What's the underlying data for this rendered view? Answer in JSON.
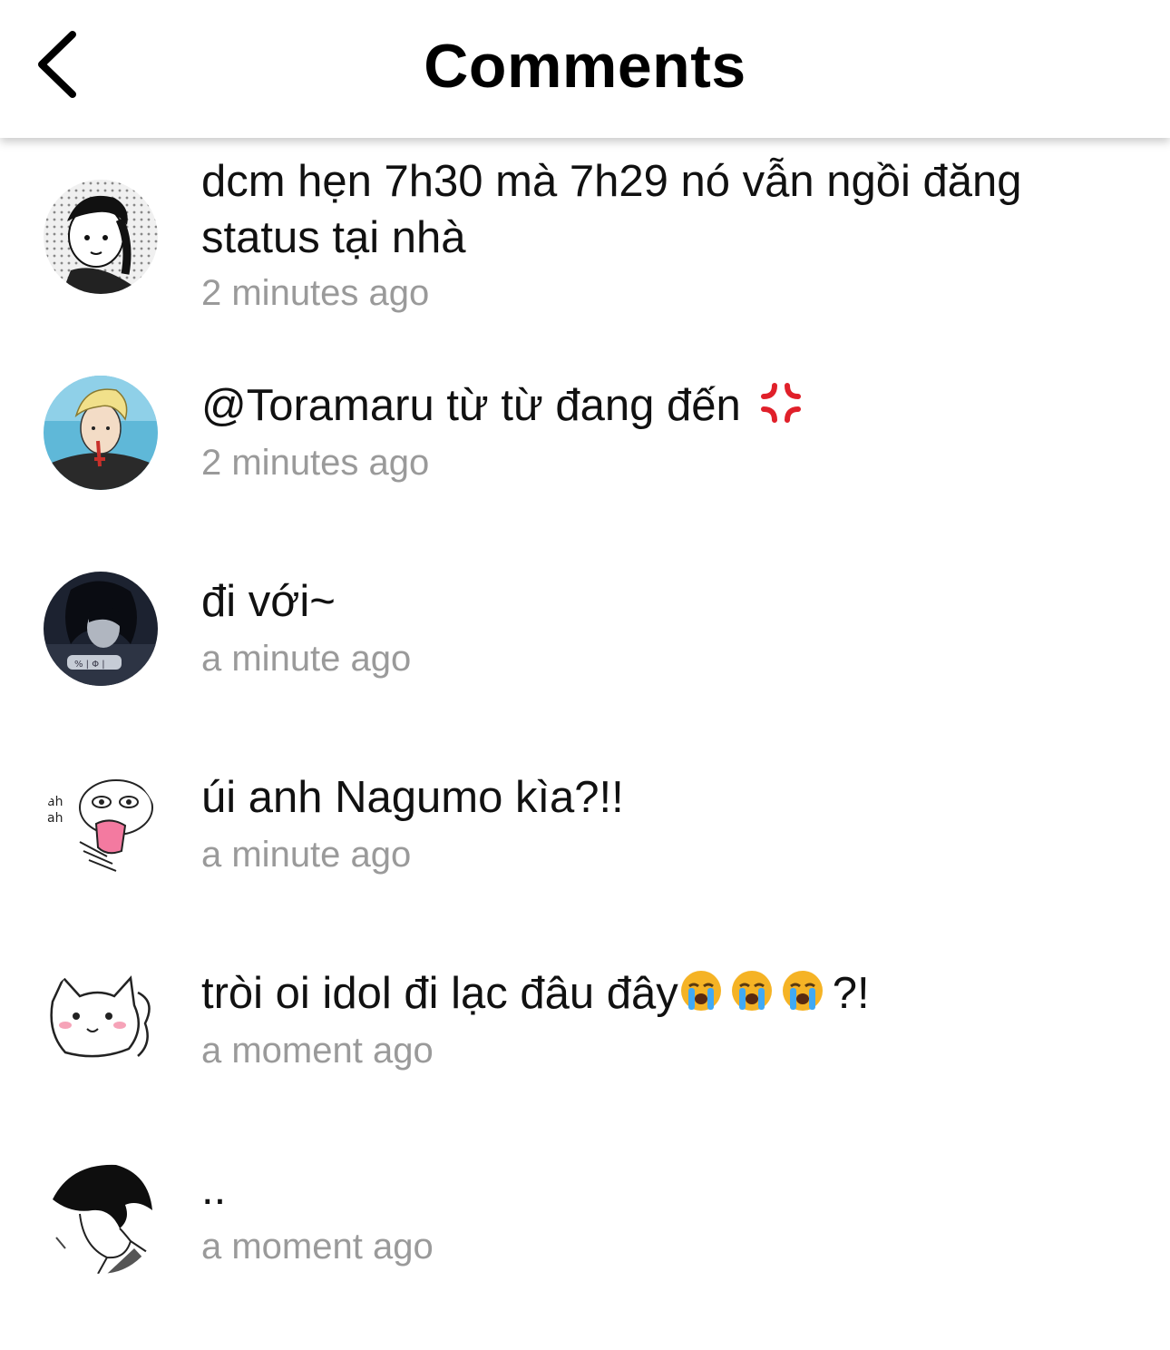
{
  "header": {
    "title": "Comments",
    "back_icon": "chevron-left-icon"
  },
  "comments": [
    {
      "text": "dcm hẹn 7h30 mà 7h29 nó vẫn ngồi đăng status tại nhà",
      "time": "2 minutes ago",
      "avatar": "manga-girl-braids-avatar"
    },
    {
      "text": "@Toramaru từ từ đang đến",
      "emoji": [
        "anger-symbol-emoji"
      ],
      "time": "2 minutes ago",
      "avatar": "blond-character-avatar"
    },
    {
      "text": "đi với~",
      "time": "a minute ago",
      "avatar": "dark-haired-character-avatar"
    },
    {
      "text": "úi anh Nagumo kìa?!!",
      "time": "a minute ago",
      "avatar": "doodle-face-avatar"
    },
    {
      "text": "tròi oi idol đi lạc đâu đây",
      "emoji": [
        "loudly-crying-face-emoji",
        "loudly-crying-face-emoji",
        "loudly-crying-face-emoji"
      ],
      "text_suffix": "?!",
      "time": "a moment ago",
      "avatar": "cat-doodle-avatar"
    },
    {
      "text": "..",
      "time": "a moment ago",
      "avatar": "manga-boy-profile-avatar"
    }
  ],
  "colors": {
    "timestamp": "#9a9a9a",
    "anger_emoji": "#e0202a",
    "crying_emoji_face": "#f5b325",
    "crying_emoji_tears": "#3fa9f5"
  }
}
